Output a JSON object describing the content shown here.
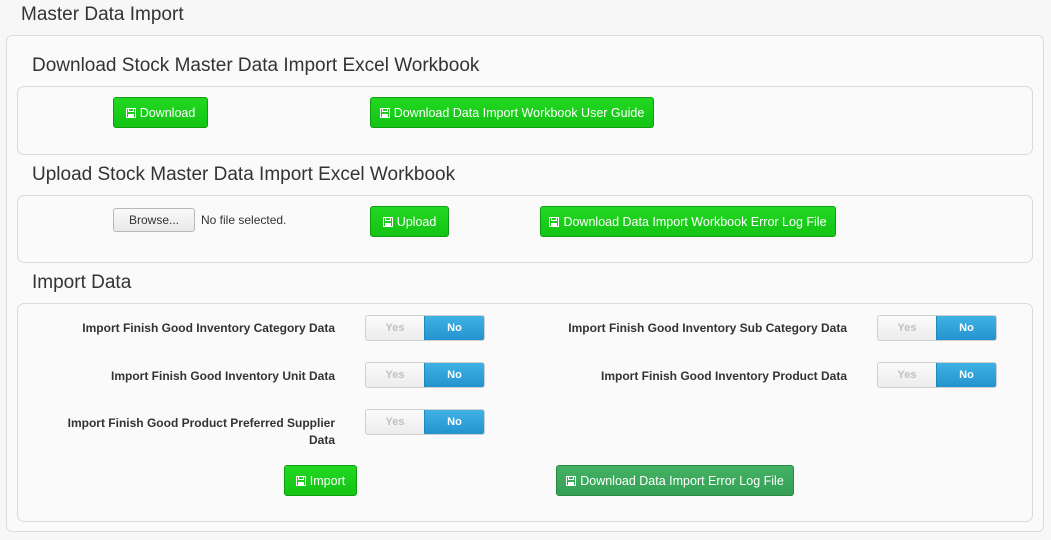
{
  "page_title": "Master Data Import",
  "sections": {
    "download_title": "Download Stock Master Data Import Excel Workbook",
    "upload_title": "Upload Stock Master Data Import Excel Workbook",
    "import_title": "Import Data"
  },
  "download": {
    "download_label": "Download",
    "guide_label": "Download Data Import Workbook User Guide"
  },
  "upload": {
    "browse_label": "Browse...",
    "file_status": "No file selected.",
    "upload_label": "Upload",
    "error_log_label": "Download Data Import Workbook Error Log File"
  },
  "import": {
    "toggles": [
      {
        "label": "Import Finish Good Inventory Category Data",
        "yes": "Yes",
        "no": "No",
        "value": "No"
      },
      {
        "label": "Import Finish Good Inventory Sub Category Data",
        "yes": "Yes",
        "no": "No",
        "value": "No"
      },
      {
        "label": "Import Finish Good Inventory Unit Data",
        "yes": "Yes",
        "no": "No",
        "value": "No"
      },
      {
        "label": "Import Finish Good Inventory Product Data",
        "yes": "Yes",
        "no": "No",
        "value": "No"
      },
      {
        "label": "Import Finish Good Product Preferred Supplier Data",
        "yes": "Yes",
        "no": "No",
        "value": "No"
      }
    ],
    "import_label": "Import",
    "error_log_label": "Download Data Import Error Log File"
  },
  "colors": {
    "button_green": "#1ed31e",
    "button_dark_green": "#3aa65a",
    "toggle_blue": "#2d9fd9"
  },
  "icons": {
    "save": "floppy-disk-icon"
  }
}
